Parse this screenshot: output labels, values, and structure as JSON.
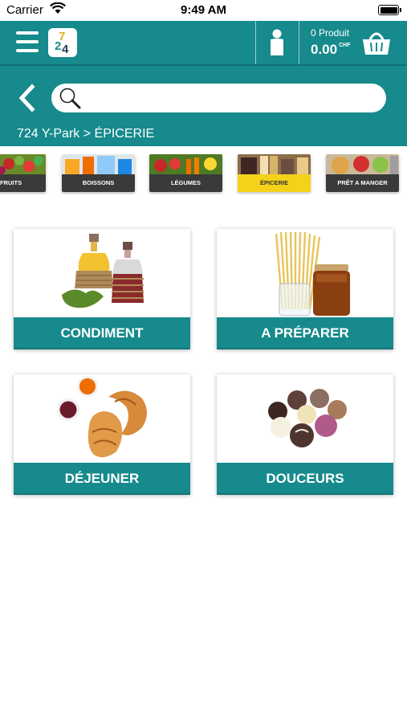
{
  "status_bar": {
    "carrier": "Carrier",
    "time": "9:49 AM"
  },
  "header": {
    "cart": {
      "count_label": "0 Produit",
      "price": "0.00",
      "currency": "CHF"
    }
  },
  "search": {
    "placeholder": ""
  },
  "breadcrumb": "724 Y-Park > ÉPICERIE",
  "categories": [
    {
      "label": "FRUITS",
      "active": false
    },
    {
      "label": "BOISSONS",
      "active": false
    },
    {
      "label": "LÉGUMES",
      "active": false
    },
    {
      "label": "ÉPICERIE",
      "active": true
    },
    {
      "label": "PRÊT A MANGER",
      "active": false
    }
  ],
  "subcategories": [
    {
      "label": "CONDIMENT"
    },
    {
      "label": "A PRÉPARER"
    },
    {
      "label": "DÉJEUNER"
    },
    {
      "label": "DOUCEURS"
    }
  ],
  "colors": {
    "primary": "#168a8c",
    "active_tab": "#f4d21a",
    "tab_label_bg": "#3a3a3a"
  }
}
